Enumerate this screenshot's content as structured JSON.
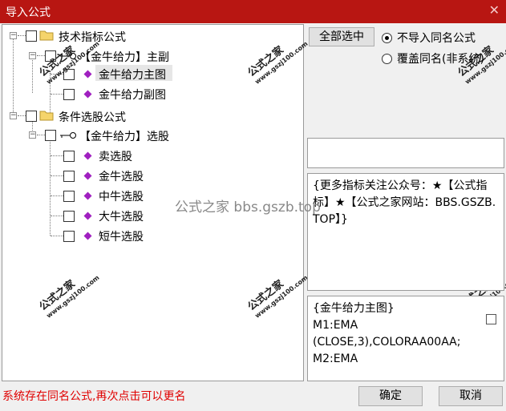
{
  "window": {
    "title": "导入公式",
    "close_icon": "close-icon"
  },
  "tree": {
    "root1": {
      "label": "技术指标公式",
      "icon": "folder-icon"
    },
    "group1": {
      "label": "【金牛给力】主副",
      "icon": "key-icon"
    },
    "items1": [
      {
        "label": "金牛给力主图",
        "icon": "gem-icon",
        "selected": true
      },
      {
        "label": "金牛给力副图",
        "icon": "gem-icon"
      }
    ],
    "root2": {
      "label": "条件选股公式",
      "icon": "folder-icon"
    },
    "group2": {
      "label": "【金牛给力】选股",
      "icon": "key-icon"
    },
    "items2": [
      {
        "label": "卖选股",
        "icon": "gem-icon"
      },
      {
        "label": "金牛选股",
        "icon": "gem-icon"
      },
      {
        "label": "中牛选股",
        "icon": "gem-icon"
      },
      {
        "label": "大牛选股",
        "icon": "gem-icon"
      },
      {
        "label": "短牛选股",
        "icon": "gem-icon"
      }
    ]
  },
  "actions": {
    "select_all": "全部选中",
    "radio_skip": "不导入同名公式",
    "radio_overwrite": "覆盖同名(非系统)",
    "ok": "确定",
    "cancel": "取消"
  },
  "description": "{更多指标关注公众号：★【公式指标】★【公式之家网站：BBS.GSZB.TOP】}",
  "formula_preview": {
    "name_line": "{金牛给力主图}",
    "lines": [
      "M1:EMA",
      "(CLOSE,3),COLORAA00AA;",
      "M2:EMA"
    ]
  },
  "status": "系统存在同名公式,再次点击可以更名",
  "watermark": {
    "text": "公式之家",
    "url": "www.gszj100.com",
    "center": "公式之家 bbs.gszb.top"
  },
  "colors": {
    "titlebar": "#b81612",
    "gem": "#a020c0",
    "status": "#e00000"
  }
}
